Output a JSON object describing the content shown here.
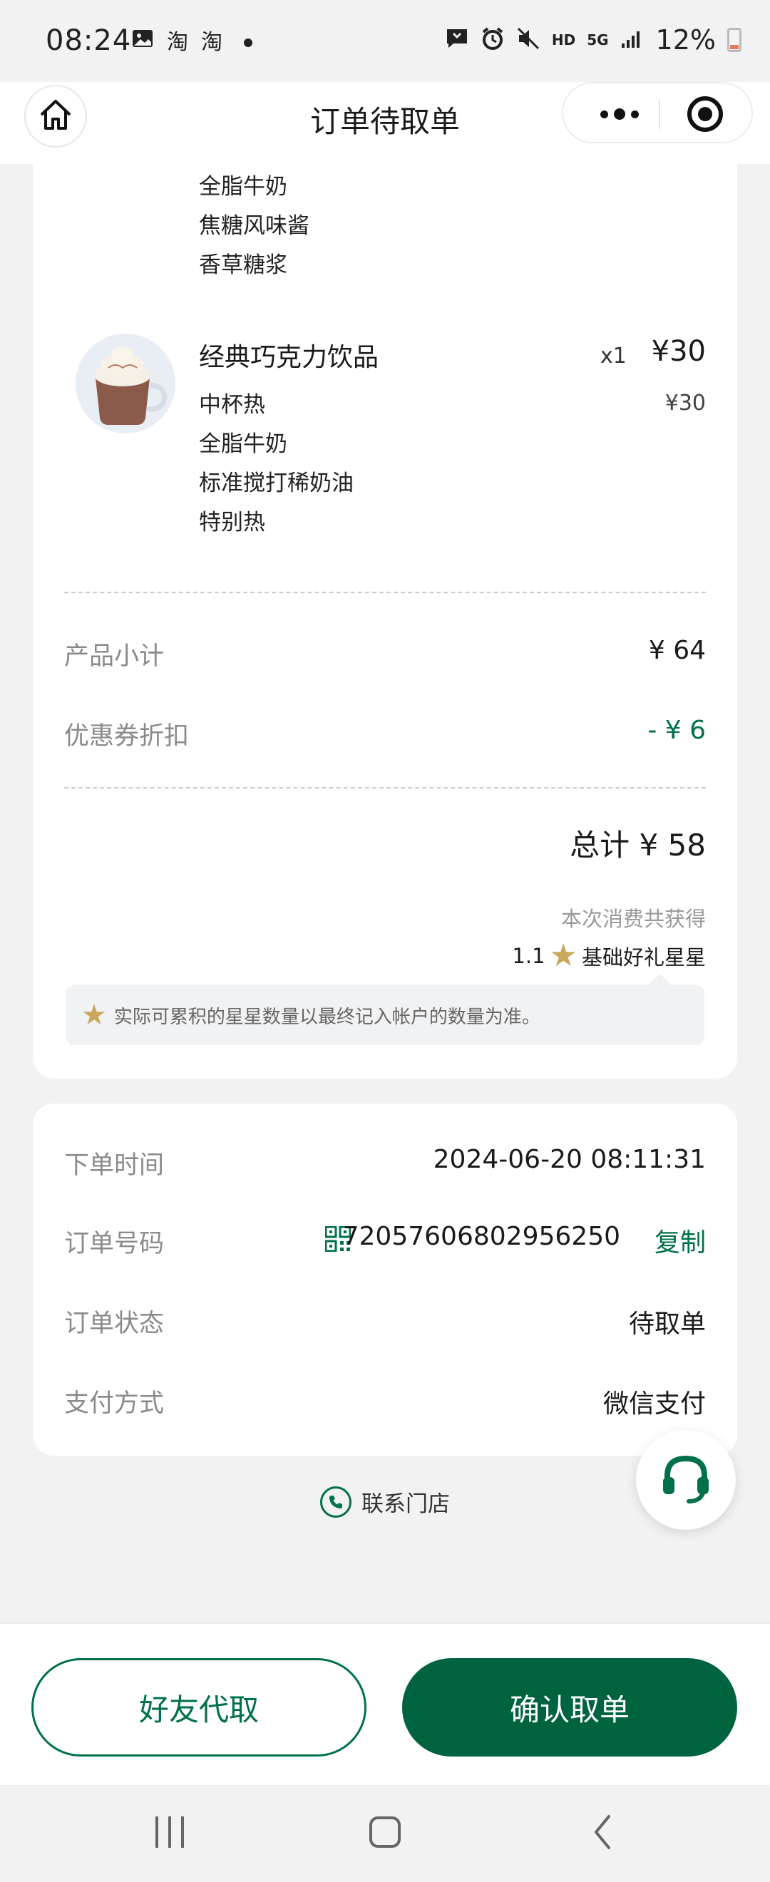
{
  "status_bar": {
    "time": "08:24",
    "left_icons": [
      "image-icon",
      "taobao-icon",
      "taobao-icon"
    ],
    "right_icons": [
      "message-icon",
      "alarm-icon",
      "mute-icon"
    ],
    "hd": "HD",
    "network": "5G",
    "battery": "12%"
  },
  "header": {
    "title": "订单待取单",
    "home_icon": "home-icon",
    "more_icon": "more-icon",
    "close_icon": "target-icon"
  },
  "previous_item": {
    "options": [
      "全脂牛奶",
      "焦糖风味酱",
      "香草糖浆"
    ]
  },
  "item": {
    "name": "经典巧克力饮品",
    "qty": "x1",
    "price": "¥30",
    "options": [
      "中杯热",
      "全脂牛奶",
      "标准搅打稀奶油",
      "特别热"
    ],
    "unit_price": "¥30"
  },
  "summary": {
    "subtotal_label": "产品小计",
    "subtotal_value": "¥ 64",
    "discount_label": "优惠券折扣",
    "discount_value": "- ¥ 6",
    "total": "总计 ¥ 58",
    "earn_caption": "本次消费共获得",
    "earn_amount": "1.1",
    "earn_label": "基础好礼星星",
    "note": "实际可累积的星星数量以最终记入帐户的数量为准。"
  },
  "order_info": {
    "time_label": "下单时间",
    "time_value": "2024-06-20 08:11:31",
    "number_label": "订单号码",
    "number_value": "72057606802956250",
    "copy_label": "复制",
    "status_label": "订单状态",
    "status_value": "待取单",
    "payment_label": "支付方式",
    "payment_value": "微信支付"
  },
  "contact": {
    "label": "联系门店"
  },
  "actions": {
    "friend_pickup": "好友代取",
    "confirm_pickup": "确认取单"
  },
  "colors": {
    "brand_green": "#00704a",
    "button_green": "#00633f",
    "star_gold": "#c9a85c"
  }
}
